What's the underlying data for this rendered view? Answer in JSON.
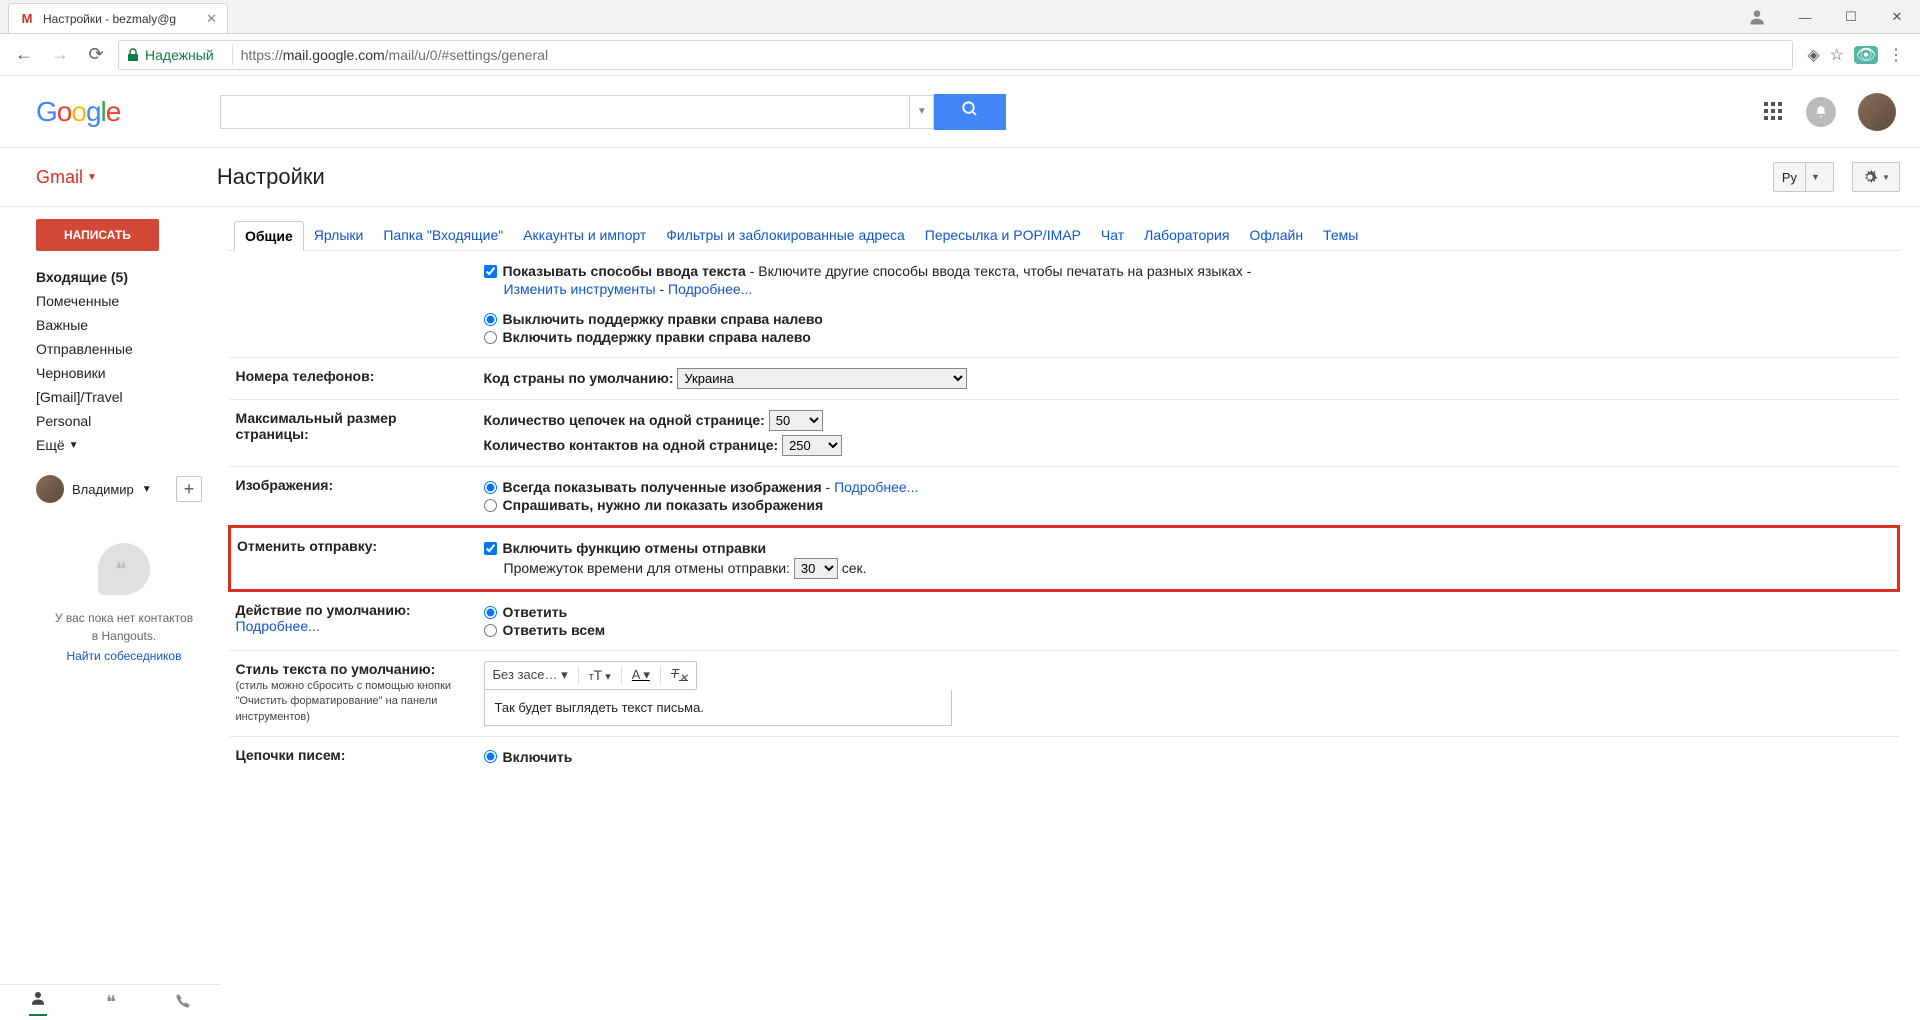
{
  "browser": {
    "tab_title": "Настройки - bezmaly@g",
    "secure_label": "Надежный",
    "url_host": "mail.google.com",
    "url_path": "/mail/u/0/#settings/general",
    "url_scheme": "https://"
  },
  "header": {
    "gmail_label": "Gmail",
    "settings_title": "Настройки",
    "lang_btn": "Ру"
  },
  "sidebar": {
    "compose": "НАПИСАТЬ",
    "items": [
      {
        "label": "Входящие",
        "count": "(5)",
        "bold": true
      },
      {
        "label": "Помеченные"
      },
      {
        "label": "Важные"
      },
      {
        "label": "Отправленные"
      },
      {
        "label": "Черновики"
      },
      {
        "label": "[Gmail]/Travel"
      },
      {
        "label": "Personal"
      },
      {
        "label": "Ещё",
        "arrow": true
      }
    ],
    "profile_name": "Владимир",
    "hangouts_line1": "У вас пока нет контактов",
    "hangouts_line2": "в Hangouts.",
    "hangouts_link": "Найти собеседников"
  },
  "tabs": [
    "Общие",
    "Ярлыки",
    "Папка \"Входящие\"",
    "Аккаунты и импорт",
    "Фильтры и заблокированные адреса",
    "Пересылка и POP/IMAP",
    "Чат",
    "Лаборатория",
    "Офлайн",
    "Темы"
  ],
  "settings": {
    "input_methods": {
      "checkbox": "Показывать способы ввода текста",
      "desc": " - Включите другие способы ввода текста, чтобы печатать на разных языках - ",
      "link1": "Изменить инструменты",
      "dash": " - ",
      "link2": "Подробнее...",
      "rtl_off": "Выключить поддержку правки справа налево",
      "rtl_on": "Включить поддержку правки справа налево"
    },
    "phone": {
      "label": "Номера телефонов:",
      "country_label": "Код страны по умолчанию:",
      "country_value": "Украина"
    },
    "pagesize": {
      "label": "Максимальный размер страницы:",
      "threads": "Количество цепочек на одной странице:",
      "threads_value": "50",
      "contacts": "Количество контактов на одной странице:",
      "contacts_value": "250"
    },
    "images": {
      "label": "Изображения:",
      "always": "Всегда показывать полученные изображения",
      "more": "Подробнее...",
      "ask": "Спрашивать, нужно ли показать изображения"
    },
    "undo": {
      "label": "Отменить отправку:",
      "enable": "Включить функцию отмены отправки",
      "period": "Промежуток времени для отмены отправки:",
      "value": "30",
      "sec": "сек."
    },
    "default_action": {
      "label": "Действие по умолчанию:",
      "more": "Подробнее...",
      "reply": "Ответить",
      "reply_all": "Ответить всем"
    },
    "text_style": {
      "label": "Стиль текста по умолчанию:",
      "sub": "(стиль можно сбросить с помощью кнопки \"Очистить форматирование\" на панели инструментов)",
      "font": "Без засе…",
      "preview": "Так будет выглядеть текст письма."
    },
    "threads": {
      "label": "Цепочки писем:",
      "on": "Включить"
    }
  }
}
